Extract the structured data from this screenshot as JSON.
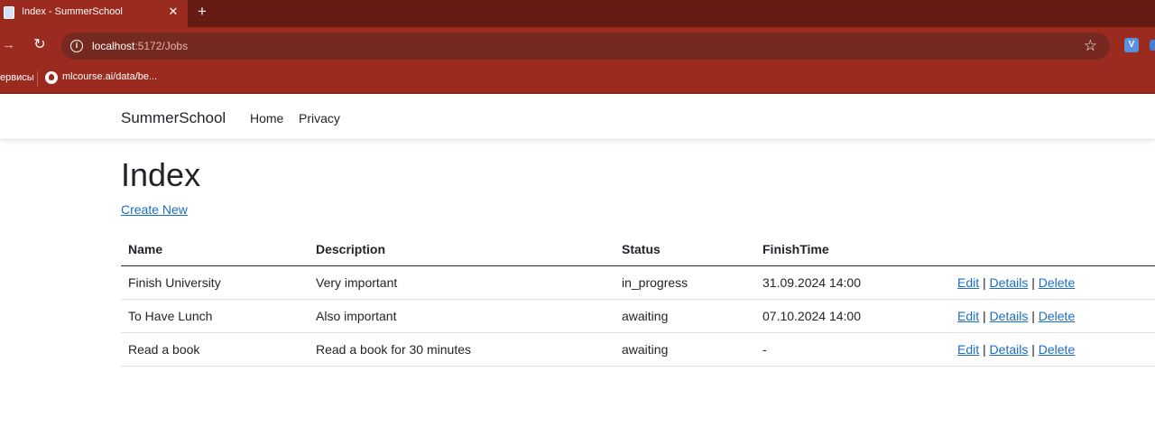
{
  "browser": {
    "tab_title": "Index - SummerSchool",
    "url_host": "localhost",
    "url_rest": ":5172/Jobs",
    "bookmarks": [
      "ервисы",
      "mlcourse.ai/data/be..."
    ]
  },
  "navbar": {
    "brand": "SummerSchool",
    "links": [
      "Home",
      "Privacy"
    ]
  },
  "main": {
    "heading": "Index",
    "create_new": "Create New",
    "table": {
      "headers": [
        "Name",
        "Description",
        "Status",
        "FinishTime"
      ],
      "rows": [
        {
          "name": "Finish University",
          "description": "Very important",
          "status": "in_progress",
          "finish_time": "31.09.2024 14:00"
        },
        {
          "name": "To Have Lunch",
          "description": "Also important",
          "status": "awaiting",
          "finish_time": "07.10.2024 14:00"
        },
        {
          "name": "Read a book",
          "description": "Read a book for 30 minutes",
          "status": "awaiting",
          "finish_time": "-"
        }
      ],
      "actions": {
        "edit": "Edit",
        "details": "Details",
        "delete": "Delete",
        "separator": "|"
      }
    }
  },
  "colors": {
    "browser_frame": "#9b2a1f",
    "tabstrip": "#661a14",
    "link": "#1b6ec2",
    "text": "#212529"
  }
}
